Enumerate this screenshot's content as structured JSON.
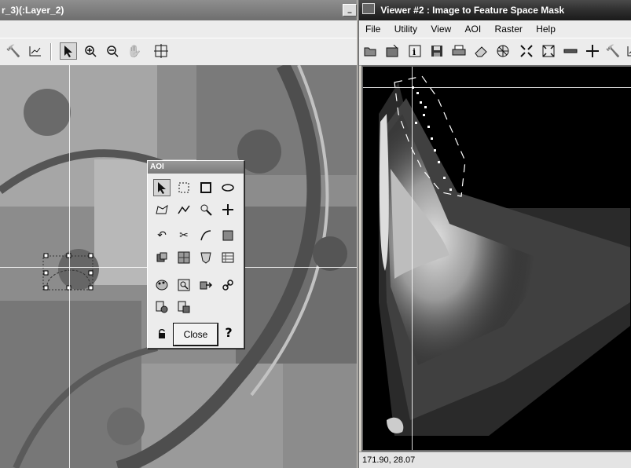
{
  "viewer1": {
    "title": "r_3)(:Layer_2)",
    "minimize_label": "_",
    "toolbar_icons": [
      "hammer-icon",
      "chart-icon",
      "pointer-icon",
      "zoom-in-icon",
      "zoom-out-icon",
      "hand-pan-icon",
      "inquire-crosshair-icon"
    ]
  },
  "viewer2": {
    "title": "Viewer #2 : Image to Feature Space Mask",
    "menu": [
      "File",
      "Utility",
      "View",
      "AOI",
      "Raster",
      "Help"
    ],
    "toolbar_icons": [
      "open-icon",
      "open-layer-icon",
      "info-icon",
      "save-icon",
      "print-icon",
      "eraser-icon",
      "network-icon",
      "fit-icon",
      "zoom-extent-icon",
      "ruler-icon",
      "crosshair-icon",
      "hammer-icon",
      "chart-icon"
    ],
    "status": "171.90, 28.07"
  },
  "aoi_palette": {
    "title": "AOI",
    "tools": [
      "pointer-icon",
      "marquee-select-icon",
      "rectangle-icon",
      "ellipse-icon",
      "polygon-icon",
      "polyline-icon",
      "region-grow-icon",
      "point-icon",
      "undo-icon",
      "cut-icon",
      "reshape-icon",
      "replace-icon",
      "union-icon",
      "seed-properties-icon",
      "aoi-styles-icon",
      "grid-icon",
      "palette-icon",
      "aoi-info-icon",
      "export-icon",
      "link-icon",
      "layer-add-icon",
      "layer-remove-icon",
      "lock-icon"
    ],
    "close_label": "Close",
    "help_label": "?"
  }
}
